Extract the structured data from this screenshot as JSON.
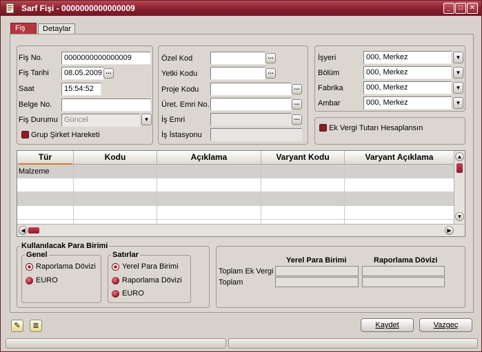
{
  "window": {
    "title": "Sarf Fişi - 0000000000000009"
  },
  "tabs": [
    {
      "label": "Fiş"
    },
    {
      "label": "Detaylar"
    }
  ],
  "left_group": {
    "fis_no": {
      "label": "Fiş No.",
      "value": "0000000000000009"
    },
    "fis_tarihi": {
      "label": "Fiş Tarihi",
      "value": "08.05.2009"
    },
    "saat": {
      "label": "Saat",
      "value": "15:54:52"
    },
    "belge_no": {
      "label": "Belge No.",
      "value": ""
    },
    "fis_durumu": {
      "label": "Fiş Durumu",
      "value": "Güncel"
    },
    "grup_sirket": {
      "label": "Grup Şirket Hareketi"
    }
  },
  "middle_group": {
    "ozel_kod": {
      "label": "Özel Kod",
      "value": ""
    },
    "yetki_kodu": {
      "label": "Yetki Kodu",
      "value": ""
    },
    "proje_kodu": {
      "label": "Proje Kodu",
      "value": ""
    },
    "uret_emri_no": {
      "label": "Üret. Emri No.",
      "value": ""
    },
    "is_emri": {
      "label": "İş Emri",
      "value": ""
    },
    "is_istasyonu": {
      "label": "İş İstasyonu",
      "value": ""
    }
  },
  "right_group": {
    "isyeri": {
      "label": "İşyeri",
      "value": "000, Merkez"
    },
    "bolum": {
      "label": "Bölüm",
      "value": "000, Merkez"
    },
    "fabrika": {
      "label": "Fabrika",
      "value": "000, Merkez"
    },
    "ambar": {
      "label": "Ambar",
      "value": "000, Merkez"
    }
  },
  "ek_vergi": {
    "label": "Ek Vergi Tutarı Hesaplansın"
  },
  "grid": {
    "columns": [
      "Tür",
      "Kodu",
      "Açıklama",
      "Varyant Kodu",
      "Varyant Açıklama"
    ],
    "rows": [
      {
        "tur": "Malzeme"
      }
    ]
  },
  "currency": {
    "title": "Kullanılacak Para Birimi",
    "genel": {
      "title": "Genel",
      "options": [
        "Raporlama Dövizi",
        "EURO"
      ],
      "selected": 0
    },
    "satirlar": {
      "title": "Satırlar",
      "options": [
        "Yerel Para Birimi",
        "Raporlama Dövizi",
        "EURO"
      ],
      "selected": 0
    }
  },
  "totals": {
    "headers": [
      "Yerel Para Birimi",
      "Raporlama Dövizi"
    ],
    "rows": [
      "Toplam Ek Vergi",
      "Toplam"
    ]
  },
  "buttons": {
    "kaydet": "Kaydet",
    "vazgec": "Vazgeç"
  },
  "colors": {
    "accent": "#8e2331",
    "title_bar": "#8e2331"
  }
}
